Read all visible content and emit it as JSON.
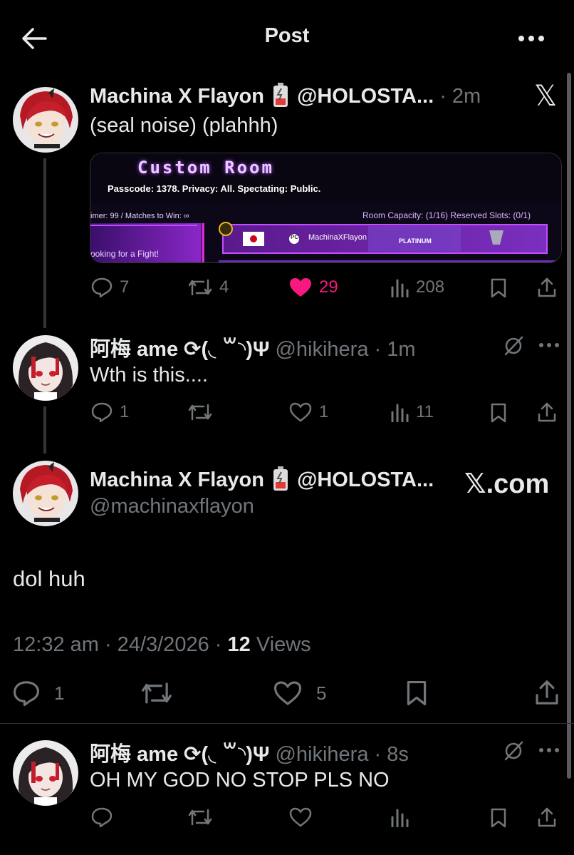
{
  "header": {
    "title": "Post"
  },
  "posts": [
    {
      "display_name": "Machina X Flayon",
      "handle": "@HOLOSTA...",
      "time": "· 2m",
      "text": "(seal noise) (plahhh)",
      "replies": "7",
      "reposts": "4",
      "likes": "29",
      "views": "208",
      "liked": true
    },
    {
      "display_name": "阿梅 ame ⟳(◟ ꒳◝)Ψ",
      "handle": "@hikihera",
      "time": "· 1m",
      "text": "Wth is this....",
      "replies": "1",
      "reposts": "",
      "likes": "1",
      "views": "11"
    }
  ],
  "main_post": {
    "display_name": "Machina X Flayon",
    "handle_short": "@HOLOSTA...",
    "handle": "@machinaxflayon",
    "watermark": "𝕏.com",
    "text": "dol huh",
    "timestamp": "12:32 am · 24/3/2026 ·",
    "views_count": "12",
    "views_label": "Views",
    "replies": "1",
    "likes": "5"
  },
  "reply": {
    "display_name": "阿梅 ame ⟳(◟ ꒳◝)Ψ",
    "handle": "@hikihera",
    "time": "· 8s",
    "text": "OH MY GOD NO STOP PLS NO"
  },
  "media": {
    "title": "Custom Room",
    "passcode_line": "Passcode: 1378. Privacy: All. Spectating: Public.",
    "timer_line": "imer: 99 / Matches to Win: ∞",
    "capacity_line": "Room Capacity: (1/16) Reserved Slots: (0/1)",
    "fight_line": "ooking for a Fight!",
    "player_tag": "PC",
    "player_name": "MachinaXFlayon",
    "rank": "PLATINUM"
  },
  "colors": {
    "background": "#000000",
    "text": "#e7e9ea",
    "muted": "#71767b",
    "like": "#f91880",
    "border": "#2f3336"
  }
}
